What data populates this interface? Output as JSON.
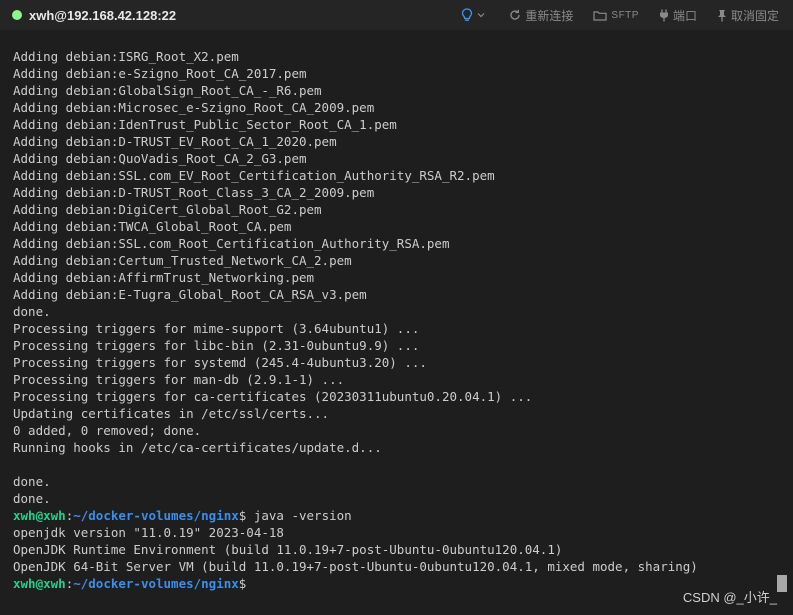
{
  "titlebar": {
    "session_title": "xwh@192.168.42.128:22",
    "status_color": "#8ef58e",
    "toolbar": {
      "reconnect_label": "重新连接",
      "sftp_label": "SFTP",
      "port_label": "端口",
      "unpin_label": "取消固定"
    }
  },
  "colors": {
    "background": "#1e1e1e",
    "titlebar": "#252526",
    "text": "#cccccc",
    "prompt_user": "#23d18b",
    "prompt_path": "#3b8eea",
    "bulb_icon": "#3794ff"
  },
  "terminal": {
    "output_lines": [
      "Adding debian:ISRG_Root_X2.pem",
      "Adding debian:e-Szigno_Root_CA_2017.pem",
      "Adding debian:GlobalSign_Root_CA_-_R6.pem",
      "Adding debian:Microsec_e-Szigno_Root_CA_2009.pem",
      "Adding debian:IdenTrust_Public_Sector_Root_CA_1.pem",
      "Adding debian:D-TRUST_EV_Root_CA_1_2020.pem",
      "Adding debian:QuoVadis_Root_CA_2_G3.pem",
      "Adding debian:SSL.com_EV_Root_Certification_Authority_RSA_R2.pem",
      "Adding debian:D-TRUST_Root_Class_3_CA_2_2009.pem",
      "Adding debian:DigiCert_Global_Root_G2.pem",
      "Adding debian:TWCA_Global_Root_CA.pem",
      "Adding debian:SSL.com_Root_Certification_Authority_RSA.pem",
      "Adding debian:Certum_Trusted_Network_CA_2.pem",
      "Adding debian:AffirmTrust_Networking.pem",
      "Adding debian:E-Tugra_Global_Root_CA_RSA_v3.pem",
      "done.",
      "Processing triggers for mime-support (3.64ubuntu1) ...",
      "Processing triggers for libc-bin (2.31-0ubuntu9.9) ...",
      "Processing triggers for systemd (245.4-4ubuntu3.20) ...",
      "Processing triggers for man-db (2.9.1-1) ...",
      "Processing triggers for ca-certificates (20230311ubuntu0.20.04.1) ...",
      "Updating certificates in /etc/ssl/certs...",
      "0 added, 0 removed; done.",
      "Running hooks in /etc/ca-certificates/update.d...",
      "",
      "done.",
      "done."
    ],
    "prompt": {
      "user_host": "xwh@xwh",
      "colon": ":",
      "path": "~/docker-volumes/nginx",
      "dollar": "$"
    },
    "command": " java -version",
    "java_output": [
      "openjdk version \"11.0.19\" 2023-04-18",
      "OpenJDK Runtime Environment (build 11.0.19+7-post-Ubuntu-0ubuntu120.04.1)",
      "OpenJDK 64-Bit Server VM (build 11.0.19+7-post-Ubuntu-0ubuntu120.04.1, mixed mode, sharing)"
    ]
  },
  "watermark": "CSDN @_小许_"
}
